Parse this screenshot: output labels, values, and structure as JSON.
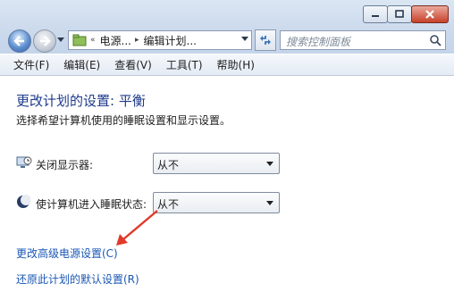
{
  "navigation": {
    "breadcrumbs": [
      "电源...",
      "编辑计划..."
    ],
    "search_placeholder": "搜索控制面板"
  },
  "menu": {
    "items": [
      "文件(F)",
      "编辑(E)",
      "查看(V)",
      "工具(T)",
      "帮助(H)"
    ]
  },
  "content": {
    "title": "更改计划的设置: 平衡",
    "description": "选择希望计算机使用的睡眠设置和显示设置。",
    "settings": [
      {
        "label": "关闭显示器:",
        "value": "从不",
        "icon": "monitor-clock-icon"
      },
      {
        "label": "使计算机进入睡眠状态:",
        "value": "从不",
        "icon": "moon-sleep-icon"
      }
    ],
    "links": {
      "advanced": "更改高级电源设置(C)",
      "restore": "还原此计划的默认设置(R)"
    }
  },
  "colors": {
    "link": "#1b57b4",
    "title": "#1e3a8a",
    "annotation_arrow": "#e03a2a"
  }
}
